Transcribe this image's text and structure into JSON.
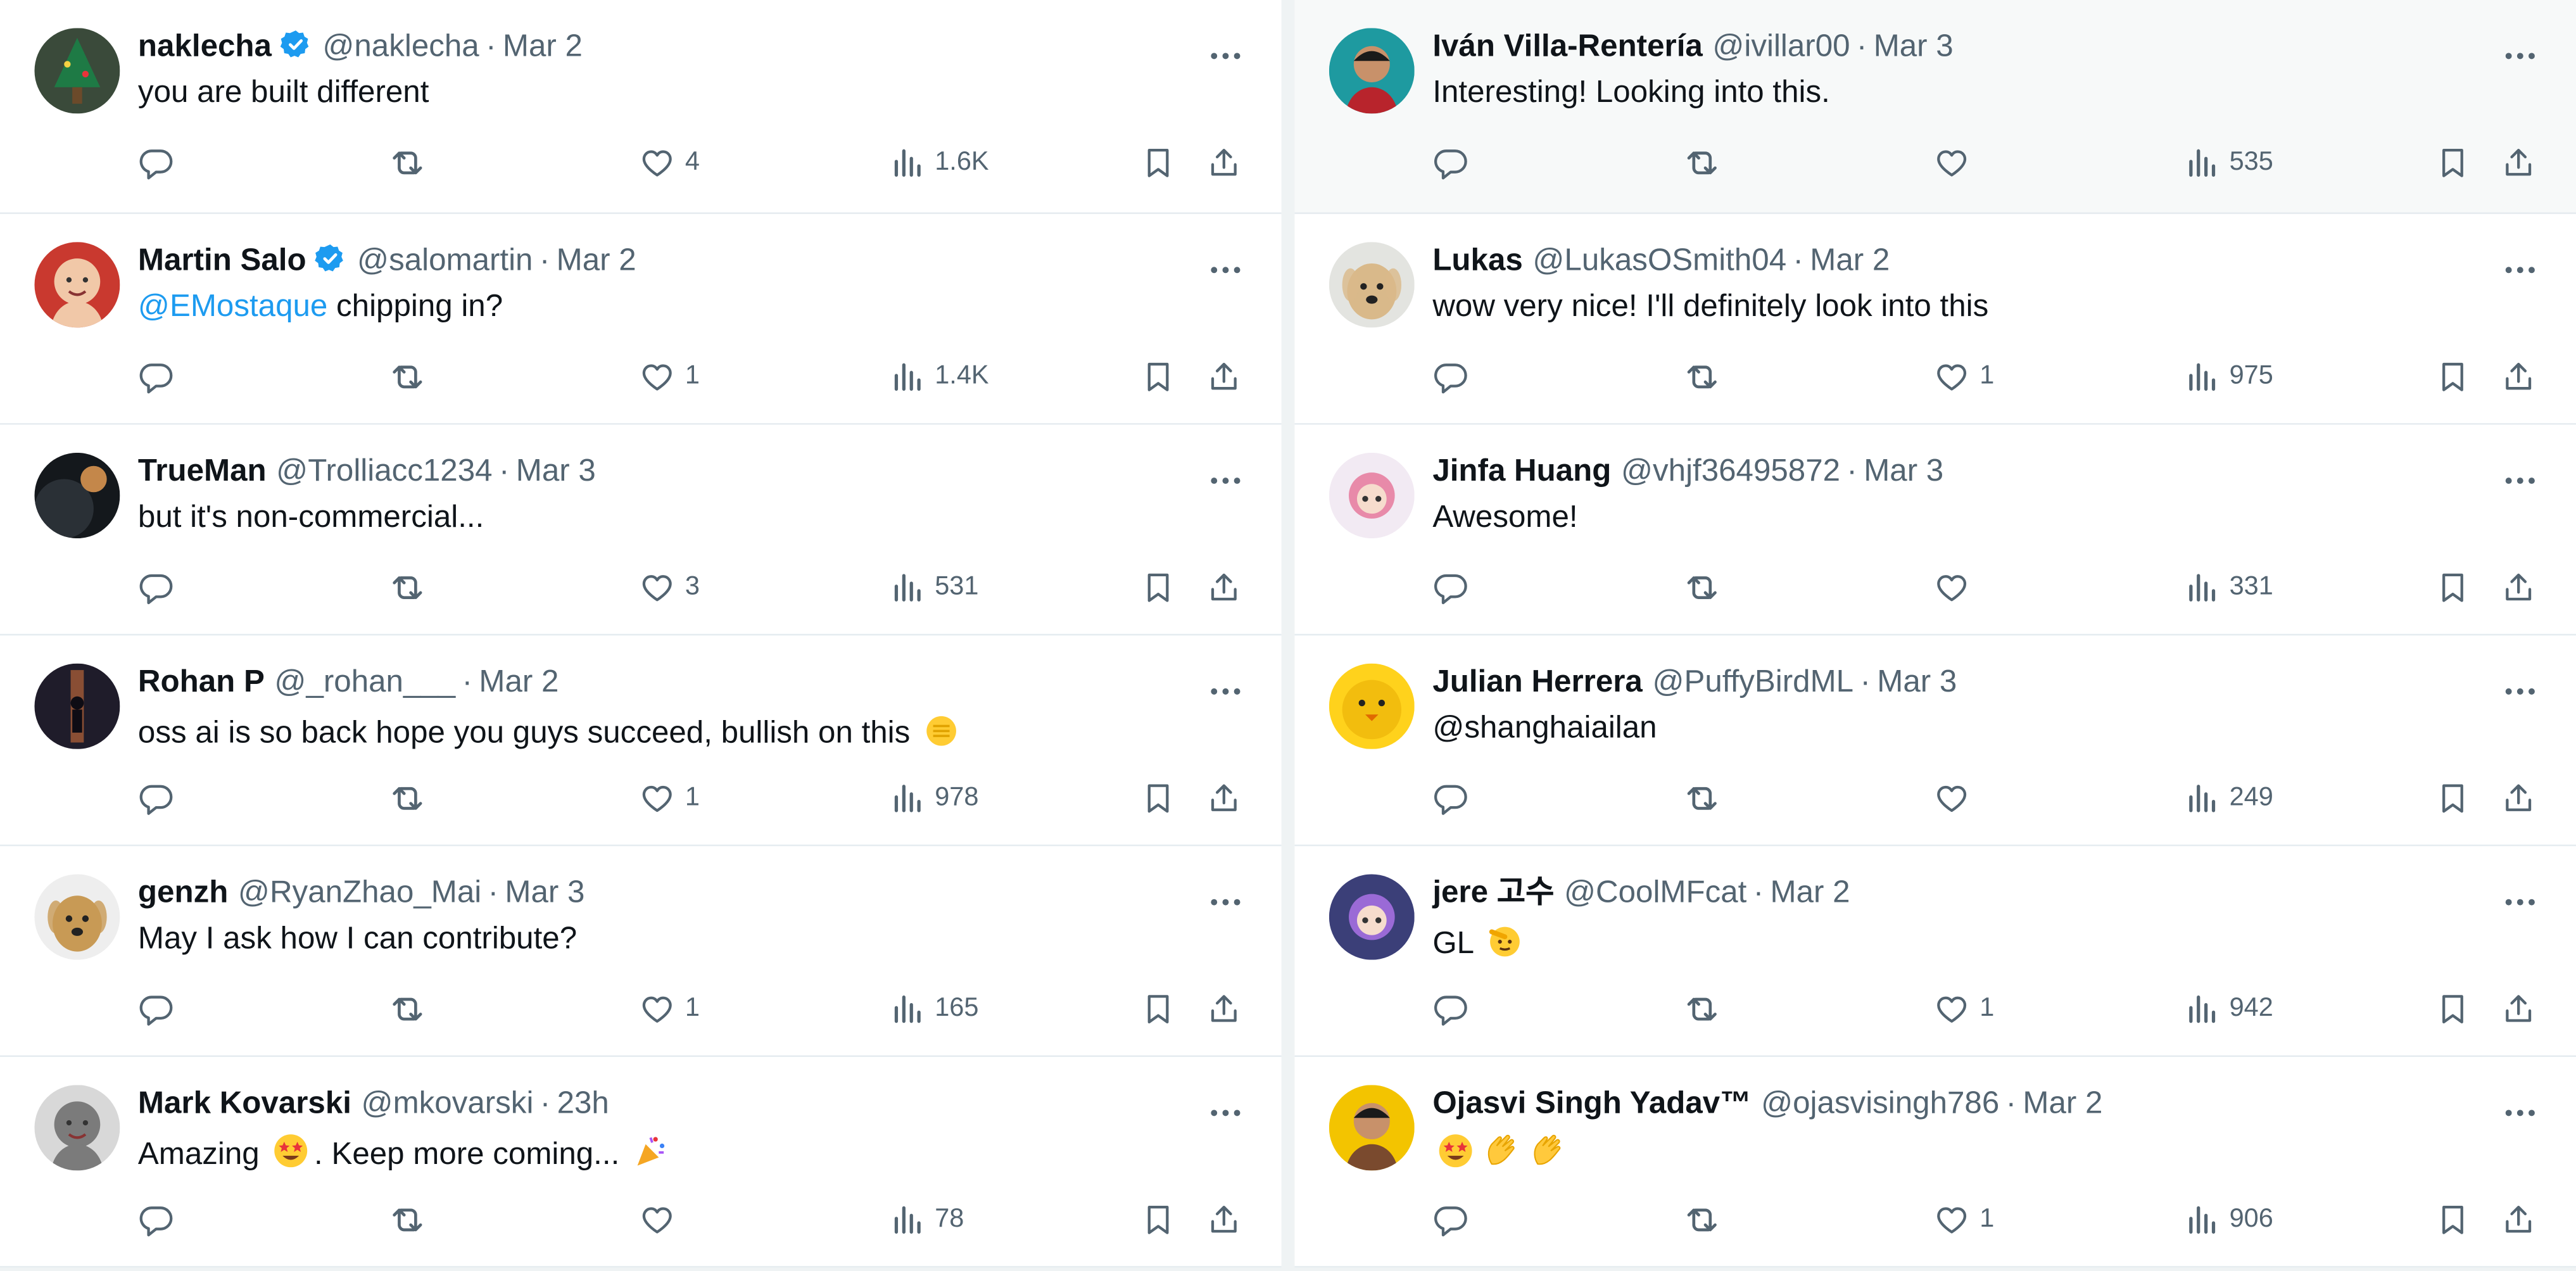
{
  "colors": {
    "accent": "#1d9bf0",
    "text": "#0f1419",
    "muted": "#536471",
    "hover_bg": "#f7f9f9"
  },
  "columns": [
    {
      "tweets": [
        {
          "name": "naklecha",
          "verified": true,
          "handle": "@naklecha",
          "sep": "·",
          "time": "Mar 2",
          "segments": [
            {
              "t": "you are built different"
            }
          ],
          "stats": {
            "replies": "",
            "retweets": "",
            "likes": "4",
            "views": "1.6K"
          },
          "avatar": {
            "bg": "#3a4a3a",
            "fg": "#1e7a45",
            "kind": "tree"
          }
        },
        {
          "name": "Martin Salo",
          "verified": true,
          "handle": "@salomartin",
          "sep": "·",
          "time": "Mar 2",
          "segments": [
            {
              "t": "@EMostaque",
              "mention": true
            },
            {
              "t": " chipping in?"
            }
          ],
          "stats": {
            "replies": "",
            "retweets": "",
            "likes": "1",
            "views": "1.4K"
          },
          "avatar": {
            "bg": "#c9392f",
            "fg": "#f1c8a8",
            "kind": "face"
          }
        },
        {
          "name": "TrueMan",
          "verified": false,
          "handle": "@Trolliacc1234",
          "sep": "·",
          "time": "Mar 3",
          "segments": [
            {
              "t": "but it's non-commercial..."
            }
          ],
          "stats": {
            "replies": "",
            "retweets": "",
            "likes": "3",
            "views": "531"
          },
          "avatar": {
            "bg": "#14181c",
            "fg": "#c4874a",
            "kind": "planet"
          }
        },
        {
          "name": "Rohan P",
          "verified": false,
          "handle": "@_rohan___",
          "sep": "·",
          "time": "Mar 2",
          "segments": [
            {
              "t": "oss ai is so back hope you guys succeed, bullish on this "
            },
            {
              "emoji": "fist-emoji"
            }
          ],
          "stats": {
            "replies": "",
            "retweets": "",
            "likes": "1",
            "views": "978"
          },
          "avatar": {
            "bg": "#1f1c2a",
            "fg": "#e0783c",
            "kind": "figure"
          }
        },
        {
          "name": "genzh",
          "verified": false,
          "handle": "@RyanZhao_Mai",
          "sep": "·",
          "time": "Mar 3",
          "segments": [
            {
              "t": "May I ask how I can contribute?"
            }
          ],
          "stats": {
            "replies": "",
            "retweets": "",
            "likes": "1",
            "views": "165"
          },
          "avatar": {
            "bg": "#eeeeee",
            "fg": "#c89a55",
            "kind": "dog"
          }
        },
        {
          "name": "Mark Kovarski",
          "verified": false,
          "handle": "@mkovarski",
          "sep": "·",
          "time": "23h",
          "segments": [
            {
              "t": "Amazing "
            },
            {
              "emoji": "star-struck-emoji"
            },
            {
              "t": ". Keep more coming... "
            },
            {
              "emoji": "party-popper-emoji"
            }
          ],
          "stats": {
            "replies": "",
            "retweets": "",
            "likes": "",
            "views": "78"
          },
          "avatar": {
            "bg": "#d8d8d8",
            "fg": "#7b7b7b",
            "kind": "face"
          }
        }
      ]
    },
    {
      "tweets": [
        {
          "name": "Iván Villa-Rentería",
          "verified": false,
          "handle": "@ivillar00",
          "sep": "·",
          "time": "Mar 3",
          "segments": [
            {
              "t": "Interesting! Looking into this."
            }
          ],
          "stats": {
            "replies": "",
            "retweets": "",
            "likes": "",
            "views": "535"
          },
          "highlight": true,
          "avatar": {
            "bg": "#1e9aa0",
            "fg": "#b8242c",
            "kind": "person"
          }
        },
        {
          "name": "Lukas",
          "verified": false,
          "handle": "@LukasOSmith04",
          "sep": "·",
          "time": "Mar 2",
          "segments": [
            {
              "t": "wow very nice! I'll definitely look into this"
            }
          ],
          "stats": {
            "replies": "",
            "retweets": "",
            "likes": "1",
            "views": "975"
          },
          "avatar": {
            "bg": "#e3e4e0",
            "fg": "#d9b98a",
            "kind": "dog"
          }
        },
        {
          "name": "Jinfa Huang",
          "verified": false,
          "handle": "@vhjf36495872",
          "sep": "·",
          "time": "Mar 3",
          "segments": [
            {
              "t": "Awesome!"
            }
          ],
          "stats": {
            "replies": "",
            "retweets": "",
            "likes": "",
            "views": "331"
          },
          "avatar": {
            "bg": "#f2eaf3",
            "fg": "#e88aa9",
            "kind": "anime"
          }
        },
        {
          "name": "Julian Herrera",
          "verified": false,
          "handle": "@PuffyBirdML",
          "sep": "·",
          "time": "Mar 3",
          "segments": [
            {
              "t": "@shanghaiailan"
            }
          ],
          "stats": {
            "replies": "",
            "retweets": "",
            "likes": "",
            "views": "249"
          },
          "avatar": {
            "bg": "#ffd21c",
            "fg": "#e6a800",
            "kind": "bird"
          }
        },
        {
          "name": "jere 고수",
          "verified": false,
          "handle": "@CoolMFcat",
          "sep": "·",
          "time": "Mar 2",
          "segments": [
            {
              "t": "GL "
            },
            {
              "emoji": "saluting-face-emoji"
            }
          ],
          "stats": {
            "replies": "",
            "retweets": "",
            "likes": "1",
            "views": "942"
          },
          "avatar": {
            "bg": "#3b3f78",
            "fg": "#9a6ad6",
            "kind": "anime"
          }
        },
        {
          "name": "Ojasvi Singh Yadav™",
          "verified": false,
          "handle": "@ojasvisingh786",
          "sep": "·",
          "time": "Mar 2",
          "segments": [
            {
              "emoji": "star-struck-emoji"
            },
            {
              "emoji": "clapping-hands-emoji"
            },
            {
              "emoji": "clapping-hands-emoji"
            }
          ],
          "stats": {
            "replies": "",
            "retweets": "",
            "likes": "1",
            "views": "906"
          },
          "avatar": {
            "bg": "#f3c400",
            "fg": "#7a4a2e",
            "kind": "person"
          }
        }
      ]
    }
  ]
}
